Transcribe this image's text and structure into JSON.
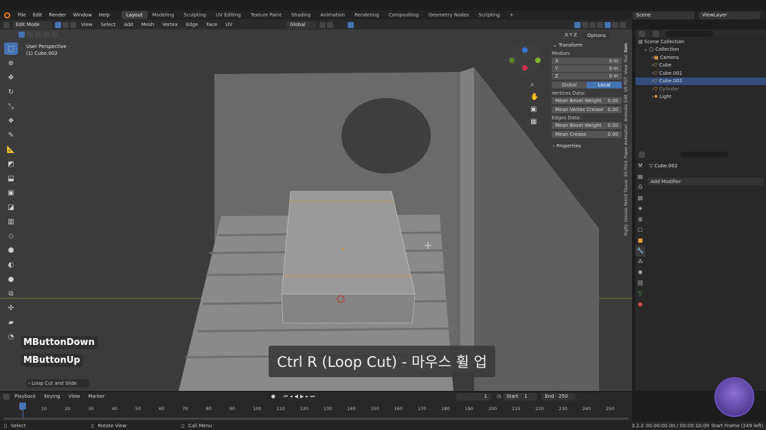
{
  "menu": [
    "File",
    "Edit",
    "Render",
    "Window",
    "Help"
  ],
  "workspaces": [
    "Layout",
    "Modeling",
    "Sculpting",
    "UV Editing",
    "Texture Paint",
    "Shading",
    "Animation",
    "Rendering",
    "Compositing",
    "Geometry Nodes",
    "Scripting"
  ],
  "active_workspace": "Layout",
  "scene": "Scene",
  "view_layer": "ViewLayer",
  "mode": "Edit Mode",
  "header_menu": [
    "View",
    "Select",
    "Add",
    "Mesh",
    "Vertex",
    "Edge",
    "Face",
    "UV"
  ],
  "orientation": "Global",
  "options": "Options",
  "xyz": [
    "X",
    "Y",
    "Z"
  ],
  "viewport_info": {
    "line1": "User Perspective",
    "line2": "(1) Cube.002"
  },
  "keys": {
    "down": "MButtonDown",
    "up": "MButtonUp"
  },
  "caption": "Ctrl R (Loop Cut) - 마우스 휠 업",
  "operator_panel": "Loop Cut and Slide",
  "transform": {
    "title": "Transform",
    "median": "Median:",
    "x_label": "X",
    "x_val": "0 m",
    "y_label": "Y",
    "y_val": "0 m",
    "z_label": "Z",
    "z_val": "0 m",
    "global": "Global",
    "local": "Local",
    "vertices_data": "Vertices Data:",
    "v_bevel_label": "Mean Bevel Weight",
    "v_bevel_val": "0.00",
    "v_crease_label": "Mean Vertex Crease",
    "v_crease_val": "0.00",
    "edges_data": "Edges Data:",
    "e_bevel_label": "Mean Bevel Weight",
    "e_bevel_val": "0.00",
    "e_crease_label": "Mean Crease",
    "e_crease_val": "0.00",
    "properties": "Properties"
  },
  "side_tabs": [
    "Item",
    "Tool",
    "View",
    "PDT",
    "VR",
    "Edit",
    "Animate",
    "Animation",
    "Paper",
    "3D-Print",
    "Tissue",
    "Grease Pencil",
    "Rigify"
  ],
  "outliner": {
    "root": "Scene Collection",
    "collection": "Collection",
    "items": [
      "Camera",
      "Cube",
      "Cube.001",
      "Cube.002",
      "Cylinder",
      "Light"
    ],
    "selected": "Cube.002"
  },
  "props": {
    "object": "Cube.002",
    "add_modifier": "Add Modifier"
  },
  "timeline": {
    "menu": [
      "Playback",
      "Keying",
      "View",
      "Marker"
    ],
    "current": "1",
    "start_label": "Start",
    "start": "1",
    "end_label": "End",
    "end": "250",
    "ticks": [
      "1",
      "10",
      "20",
      "30",
      "40",
      "50",
      "60",
      "70",
      "80",
      "90",
      "100",
      "110",
      "120",
      "130",
      "140",
      "150",
      "160",
      "170",
      "180",
      "190",
      "200",
      "210",
      "220",
      "230",
      "240",
      "250"
    ]
  },
  "status": {
    "select": "Select",
    "rotate": "Rotate View",
    "menu": "Call Menu",
    "version": "3.2.2",
    "timecode": "00:00:00.00 / 00:00:10:09",
    "frames": "Start Frame (249 left)"
  },
  "colors": {
    "accent": "#4772b3",
    "selected_row": "#334d80",
    "header": "#232323"
  }
}
